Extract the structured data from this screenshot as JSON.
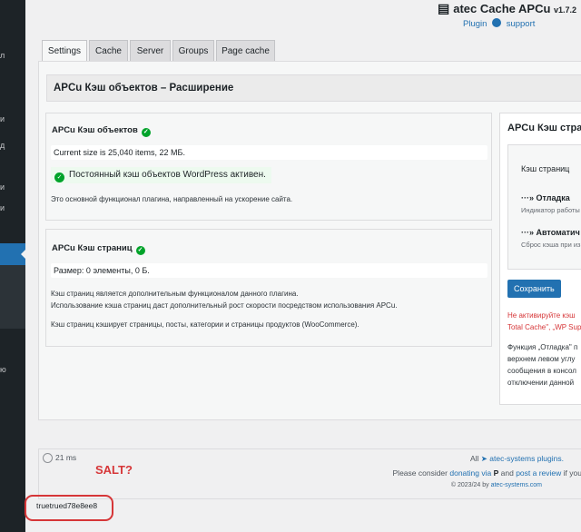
{
  "admin_sidebar": {
    "fragments": [
      "л",
      "и",
      "д",
      "и",
      "и",
      "ю"
    ]
  },
  "header": {
    "title": "atec Cache APCu",
    "version": "v1.7.2",
    "plugin_link": "Plugin",
    "support_link": "support"
  },
  "tabs": [
    "Settings",
    "Cache",
    "Server",
    "Groups",
    "Page cache"
  ],
  "panel_title": "APCu Кэш объектов – Расширение",
  "object_cache": {
    "title": "APCu Кэш объектов",
    "current_size": "Current size is 25,040 items, 22 МБ.",
    "status": "Постоянный кэш объектов WordPress активен.",
    "description": "Это основной функционал плагина, направленный на ускорение сайта."
  },
  "page_cache": {
    "title": "APCu Кэш страниц",
    "size": "Размер: 0 элементы, 0 Б.",
    "desc1": "Кэш страниц является дополнительным функционалом данного плагина.",
    "desc2": "Использование кэша страниц даст дополнительный рост скорости посредством использования APCu.",
    "desc3": "Кэш страниц кэширует страницы, посты, категории и страницы продуктов (WooCommerce)."
  },
  "right_panel": {
    "title": "APCu Кэш стран",
    "section": "Кэш страниц",
    "debug_label": "···» Отладка",
    "debug_desc": "Индикатор работы",
    "auto_label": "···» Автоматич",
    "auto_desc": "Сброс кэша при из",
    "save_button": "Сохранить",
    "warning1": "Не активируйте кэш",
    "warning2": "Total Cache\", „WP Sup",
    "note1": "Функция „Отладка\" п",
    "note2": "верхнем левом углу",
    "note3": "сообщения в консол",
    "note4": "отключении данной"
  },
  "footer": {
    "time": "21 ms",
    "salt_label": "SALT?",
    "all": "All",
    "plugins_link": "atec-systems plugins.",
    "consider": "Please consider",
    "donating": "donating via",
    "and": "and",
    "review": "post a review",
    "if_you": "if you",
    "copyright": "© 2023/24 by",
    "site": "atec-systems.com"
  },
  "salt_value": "truetrued78e8ee8",
  "colors": {
    "accent": "#2271b1",
    "success": "#00a32a",
    "error": "#d63638"
  }
}
